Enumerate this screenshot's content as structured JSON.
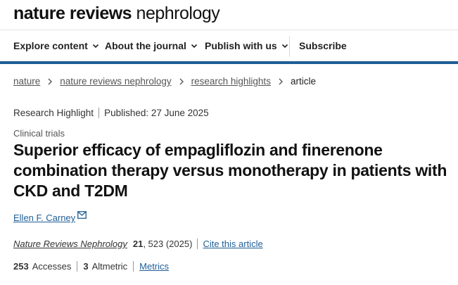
{
  "header": {
    "logo_bold": "nature reviews",
    "logo_regular": "nephrology"
  },
  "nav": {
    "items": [
      {
        "label": "Explore content",
        "has_dropdown": true
      },
      {
        "label": "About the journal",
        "has_dropdown": true
      },
      {
        "label": "Publish with us",
        "has_dropdown": true
      },
      {
        "label": "Subscribe",
        "has_dropdown": false
      }
    ],
    "accent_color": "#1f5e96"
  },
  "breadcrumb": {
    "items": [
      "nature",
      "nature reviews nephrology",
      "research highlights"
    ],
    "current": "article"
  },
  "article": {
    "type": "Research Highlight",
    "published": "Published: 27 June 2025",
    "subject": "Clinical trials",
    "title": "Superior efficacy of empagliflozin and finerenone combination therapy versus monotherapy in patients with CKD and T2DM",
    "author": "Ellen F. Carney",
    "journal": "Nature Reviews Nephrology",
    "volume": "21",
    "pages_year": ", 523 (2025)",
    "cite_label": "Cite this article"
  },
  "metrics": {
    "accesses_count": "253",
    "accesses_label": "Accesses",
    "altmetric_count": "3",
    "altmetric_label": "Altmetric",
    "metrics_link": "Metrics"
  }
}
